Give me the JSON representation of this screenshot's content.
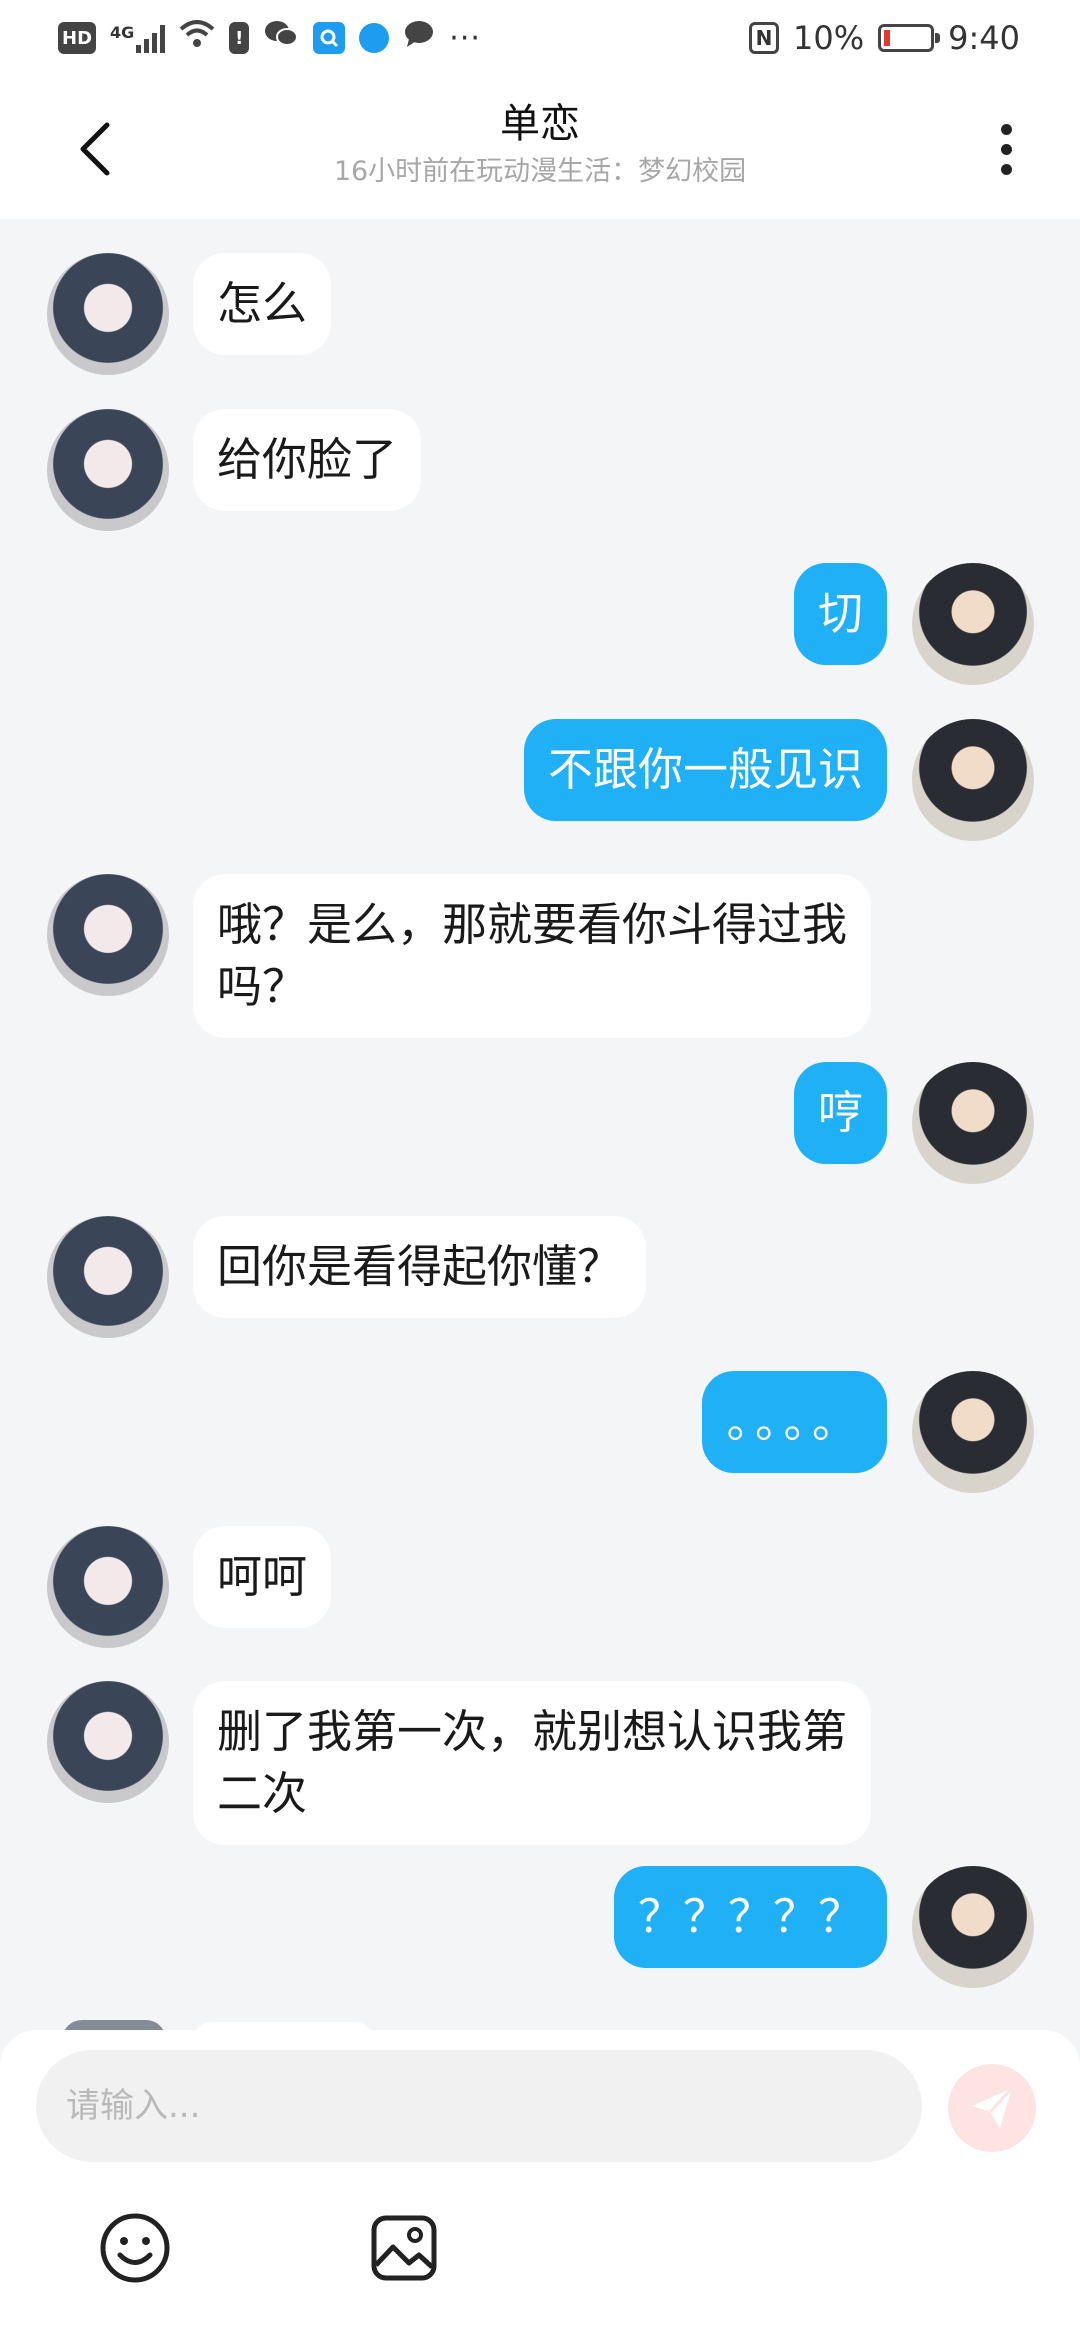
{
  "status_bar": {
    "hd": "HD",
    "network": "4G",
    "battery": "10%",
    "time": "9:40",
    "icons": [
      "hd-icon",
      "4g-signal-icon",
      "wifi-icon",
      "alert-icon",
      "wechat-icon",
      "search-app-icon",
      "browser-icon",
      "message-icon",
      "more-dots-icon",
      "nfc-icon",
      "battery-icon"
    ]
  },
  "header": {
    "title": "单恋",
    "subtitle": "16小时前在玩动漫生活：梦幻校园",
    "back_icon": "chevron-left-icon",
    "more_icon": "more-vertical-icon"
  },
  "messages": [
    {
      "side": "left",
      "text": "怎么"
    },
    {
      "side": "left",
      "text": "给你脸了"
    },
    {
      "side": "right",
      "text": "切"
    },
    {
      "side": "right",
      "text": "不跟你一般见识"
    },
    {
      "side": "left",
      "text": "哦？是么，那就要看你斗得过我\n吗？"
    },
    {
      "side": "right",
      "text": "哼"
    },
    {
      "side": "left",
      "text": "回你是看得起你懂？"
    },
    {
      "side": "right",
      "text": "。。。。"
    },
    {
      "side": "left",
      "text": "呵呵"
    },
    {
      "side": "left",
      "text": "删了我第一次，就别想认识我第\n二次"
    },
    {
      "side": "right",
      "text": "？？？？？"
    }
  ],
  "composer": {
    "placeholder": "请输入...",
    "send_icon": "send-icon",
    "emoji_icon": "emoji-icon",
    "image_icon": "image-icon"
  },
  "colors": {
    "accent": "#1fb0f6",
    "background": "#f4f5f7",
    "send_button": "#fde3e1"
  }
}
